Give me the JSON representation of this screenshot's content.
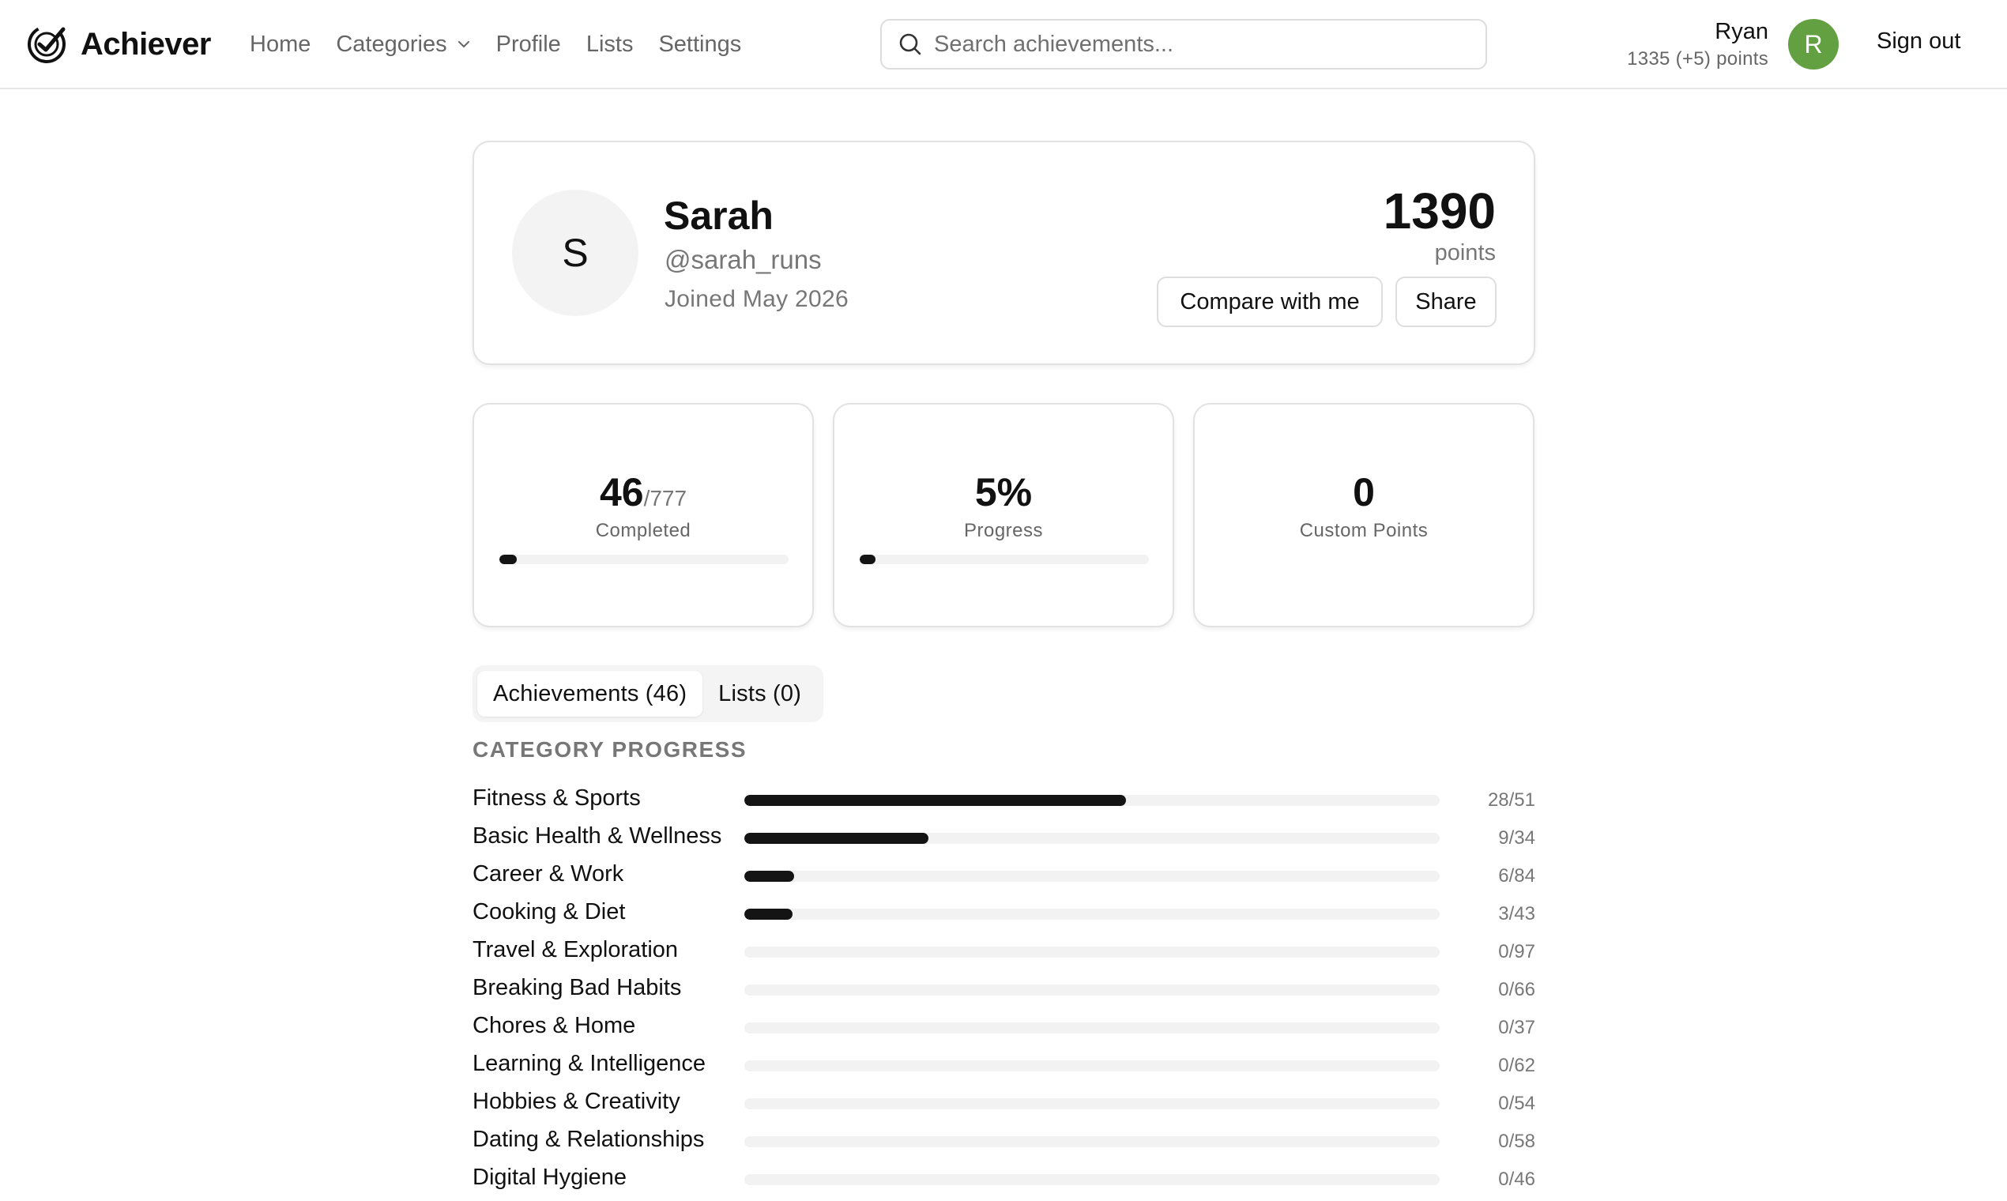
{
  "app": {
    "name": "Achiever"
  },
  "nav": {
    "items": [
      {
        "label": "Home"
      },
      {
        "label": "Categories",
        "has_dropdown": true
      },
      {
        "label": "Profile"
      },
      {
        "label": "Lists"
      },
      {
        "label": "Settings"
      }
    ]
  },
  "search": {
    "placeholder": "Search achievements...",
    "value": ""
  },
  "current_user": {
    "name": "Ryan",
    "points_text": "1335 (+5) points",
    "avatar_initial": "R",
    "avatar_color": "#62a041",
    "sign_out_label": "Sign out"
  },
  "profile": {
    "avatar_initial": "S",
    "name": "Sarah",
    "handle": "@sarah_runs",
    "joined": "Joined May 2026",
    "points": "1390",
    "points_label": "points",
    "compare_label": "Compare with me",
    "share_label": "Share"
  },
  "stats": {
    "completed": {
      "value": "46",
      "total": "/777",
      "label": "Completed",
      "progress": 0.059
    },
    "progress": {
      "value": "5%",
      "label": "Progress",
      "progress": 0.05
    },
    "custom": {
      "value": "0",
      "label": "Custom Points"
    }
  },
  "tabs": [
    {
      "label": "Achievements (46)",
      "active": true
    },
    {
      "label": "Lists (0)",
      "active": false
    }
  ],
  "category_progress": {
    "title": "CATEGORY PROGRESS",
    "items": [
      {
        "name": "Fitness & Sports",
        "done": 28,
        "total": 51,
        "count": "28/51"
      },
      {
        "name": "Basic Health & Wellness",
        "done": 9,
        "total": 34,
        "count": "9/34"
      },
      {
        "name": "Career & Work",
        "done": 6,
        "total": 84,
        "count": "6/84"
      },
      {
        "name": "Cooking & Diet",
        "done": 3,
        "total": 43,
        "count": "3/43"
      },
      {
        "name": "Travel & Exploration",
        "done": 0,
        "total": 97,
        "count": "0/97"
      },
      {
        "name": "Breaking Bad Habits",
        "done": 0,
        "total": 66,
        "count": "0/66"
      },
      {
        "name": "Chores & Home",
        "done": 0,
        "total": 37,
        "count": "0/37"
      },
      {
        "name": "Learning & Intelligence",
        "done": 0,
        "total": 62,
        "count": "0/62"
      },
      {
        "name": "Hobbies & Creativity",
        "done": 0,
        "total": 54,
        "count": "0/54"
      },
      {
        "name": "Dating & Relationships",
        "done": 0,
        "total": 58,
        "count": "0/58"
      },
      {
        "name": "Digital Hygiene",
        "done": 0,
        "total": 46,
        "count": "0/46"
      }
    ]
  },
  "colors": {
    "accent": "#141414",
    "track": "#f2f2f2",
    "muted_text": "#777777"
  }
}
